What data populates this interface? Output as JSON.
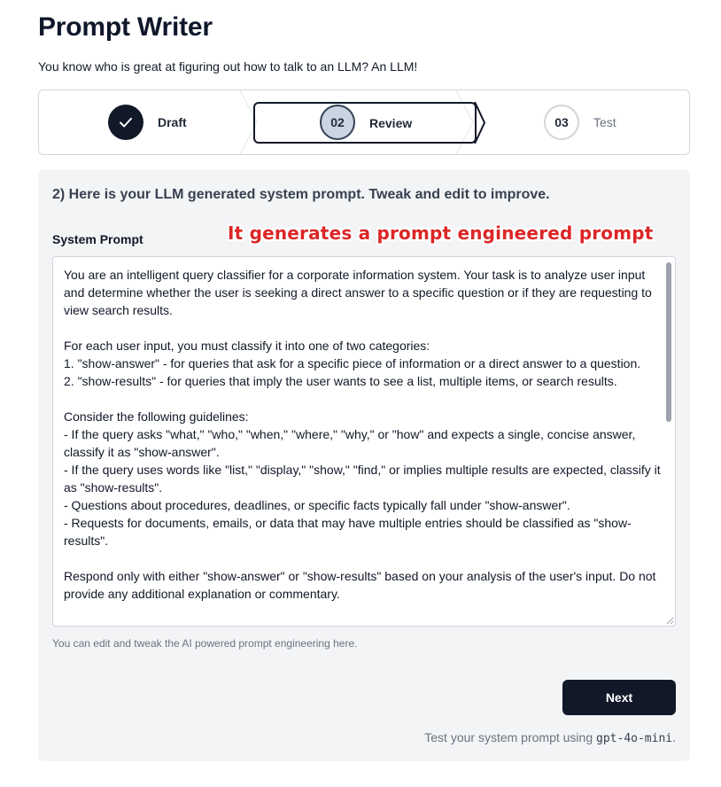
{
  "header": {
    "title": "Prompt Writer",
    "subtitle": "You know who is great at figuring out how to talk to an LLM? An LLM!"
  },
  "stepper": {
    "steps": [
      {
        "number": "",
        "label": "Draft",
        "state": "complete",
        "icon": "check-icon"
      },
      {
        "number": "02",
        "label": "Review",
        "state": "current"
      },
      {
        "number": "03",
        "label": "Test",
        "state": "upcoming"
      }
    ]
  },
  "main": {
    "heading": "2) Here is your LLM generated system prompt. Tweak and edit to improve.",
    "field_label": "System Prompt",
    "annotation": "It generates a prompt engineered prompt",
    "system_prompt": "You are an intelligent query classifier for a corporate information system. Your task is to analyze user input and determine whether the user is seeking a direct answer to a specific question or if they are requesting to view search results.\n\nFor each user input, you must classify it into one of two categories:\n1. \"show-answer\" - for queries that ask for a specific piece of information or a direct answer to a question.\n2. \"show-results\" - for queries that imply the user wants to see a list, multiple items, or search results.\n\nConsider the following guidelines:\n- If the query asks \"what,\" \"who,\" \"when,\" \"where,\" \"why,\" or \"how\" and expects a single, concise answer, classify it as \"show-answer\".\n- If the query uses words like \"list,\" \"display,\" \"show,\" \"find,\" or implies multiple results are expected, classify it as \"show-results\".\n- Questions about procedures, deadlines, or specific facts typically fall under \"show-answer\".\n- Requests for documents, emails, or data that may have multiple entries should be classified as \"show-results\".\n\nRespond only with either \"show-answer\" or \"show-results\" based on your analysis of the user's input. Do not provide any additional explanation or commentary.",
    "helper_text": "You can edit and tweak the AI powered prompt engineering here.",
    "next_label": "Next",
    "footnote_prefix": "Test your system prompt using ",
    "footnote_model": "gpt-4o-mini",
    "footnote_suffix": "."
  },
  "colors": {
    "primary": "#111827",
    "annotation": "#dc2626",
    "card_bg": "#f3f4f6"
  }
}
